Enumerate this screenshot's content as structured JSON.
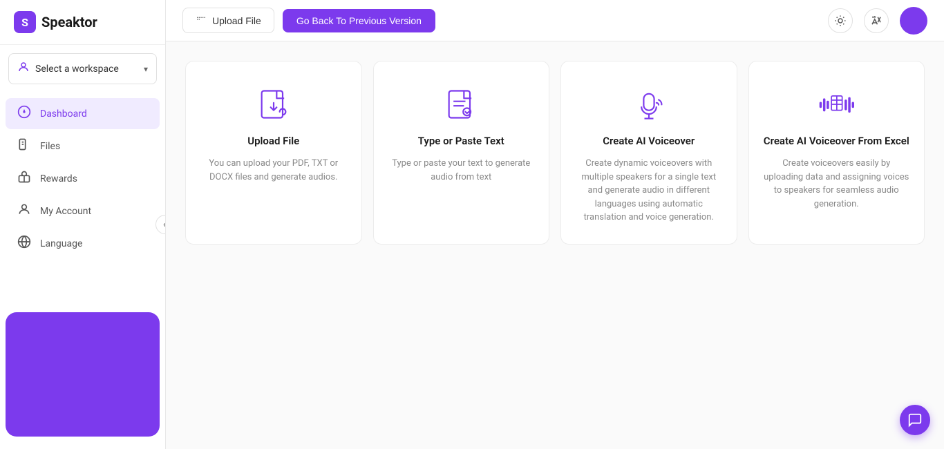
{
  "app": {
    "name": "Speaktor",
    "logo_letter": "S"
  },
  "sidebar": {
    "workspace": {
      "label": "Select a workspace",
      "chevron": "▾"
    },
    "nav_items": [
      {
        "id": "dashboard",
        "label": "Dashboard",
        "icon": "dashboard",
        "active": true
      },
      {
        "id": "files",
        "label": "Files",
        "icon": "files",
        "active": false
      },
      {
        "id": "rewards",
        "label": "Rewards",
        "icon": "rewards",
        "active": false
      },
      {
        "id": "my-account",
        "label": "My Account",
        "icon": "account",
        "active": false
      },
      {
        "id": "language",
        "label": "Language",
        "icon": "language",
        "active": false
      }
    ],
    "collapse_label": "«"
  },
  "header": {
    "upload_button": "Upload File",
    "version_button": "Go Back To Previous Version",
    "theme_icon": "☀",
    "translate_icon": "A"
  },
  "cards": [
    {
      "id": "upload-file",
      "title": "Upload File",
      "description": "You can upload your PDF, TXT or DOCX files and generate audios.",
      "icon_type": "upload-file"
    },
    {
      "id": "type-paste",
      "title": "Type or Paste Text",
      "description": "Type or paste your text to generate audio from text",
      "icon_type": "type-paste"
    },
    {
      "id": "ai-voiceover",
      "title": "Create AI Voiceover",
      "description": "Create dynamic voiceovers with multiple speakers for a single text and generate audio in different languages using automatic translation and voice generation.",
      "icon_type": "ai-voiceover"
    },
    {
      "id": "excel-voiceover",
      "title": "Create AI Voiceover From Excel",
      "description": "Create voiceovers easily by uploading data and assigning voices to speakers for seamless audio generation.",
      "icon_type": "excel-voiceover"
    }
  ],
  "chat_bubble_icon": "💬"
}
